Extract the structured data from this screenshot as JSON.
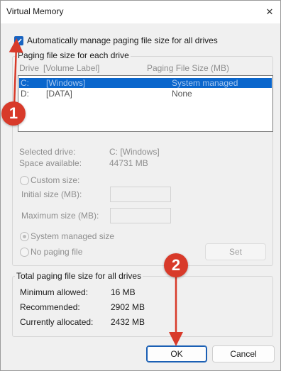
{
  "window": {
    "title": "Virtual Memory",
    "close_glyph": "✕"
  },
  "auto_manage": {
    "label": "Automatically manage paging file size for all drives",
    "checked": true
  },
  "paging_group": {
    "legend": "Paging file size for each drive",
    "columns": {
      "drive": "Drive",
      "volume": "[Volume Label]",
      "size": "Paging File Size (MB)"
    },
    "drives": [
      {
        "drive": "C:",
        "label": "[Windows]",
        "size": "System managed",
        "selected": true
      },
      {
        "drive": "D:",
        "label": "[DATA]",
        "size": "None",
        "selected": false
      }
    ],
    "selected_drive_label": "Selected drive:",
    "selected_drive_value": "C:  [Windows]",
    "space_available_label": "Space available:",
    "space_available_value": "44731 MB",
    "custom_size_label": "Custom size:",
    "initial_size_label": "Initial size (MB):",
    "maximum_size_label": "Maximum size (MB):",
    "system_managed_label": "System managed size",
    "no_paging_label": "No paging file",
    "set_label": "Set"
  },
  "totals_group": {
    "legend": "Total paging file size for all drives",
    "minimum_label": "Minimum allowed:",
    "minimum_value": "16 MB",
    "recommended_label": "Recommended:",
    "recommended_value": "2902 MB",
    "allocated_label": "Currently allocated:",
    "allocated_value": "2432 MB"
  },
  "buttons": {
    "ok": "OK",
    "cancel": "Cancel"
  },
  "annotations": {
    "step1": "1",
    "step2": "2",
    "color": "#d83a2a"
  },
  "colors": {
    "accent": "#0a66cc",
    "checkbox": "#1863c0"
  }
}
